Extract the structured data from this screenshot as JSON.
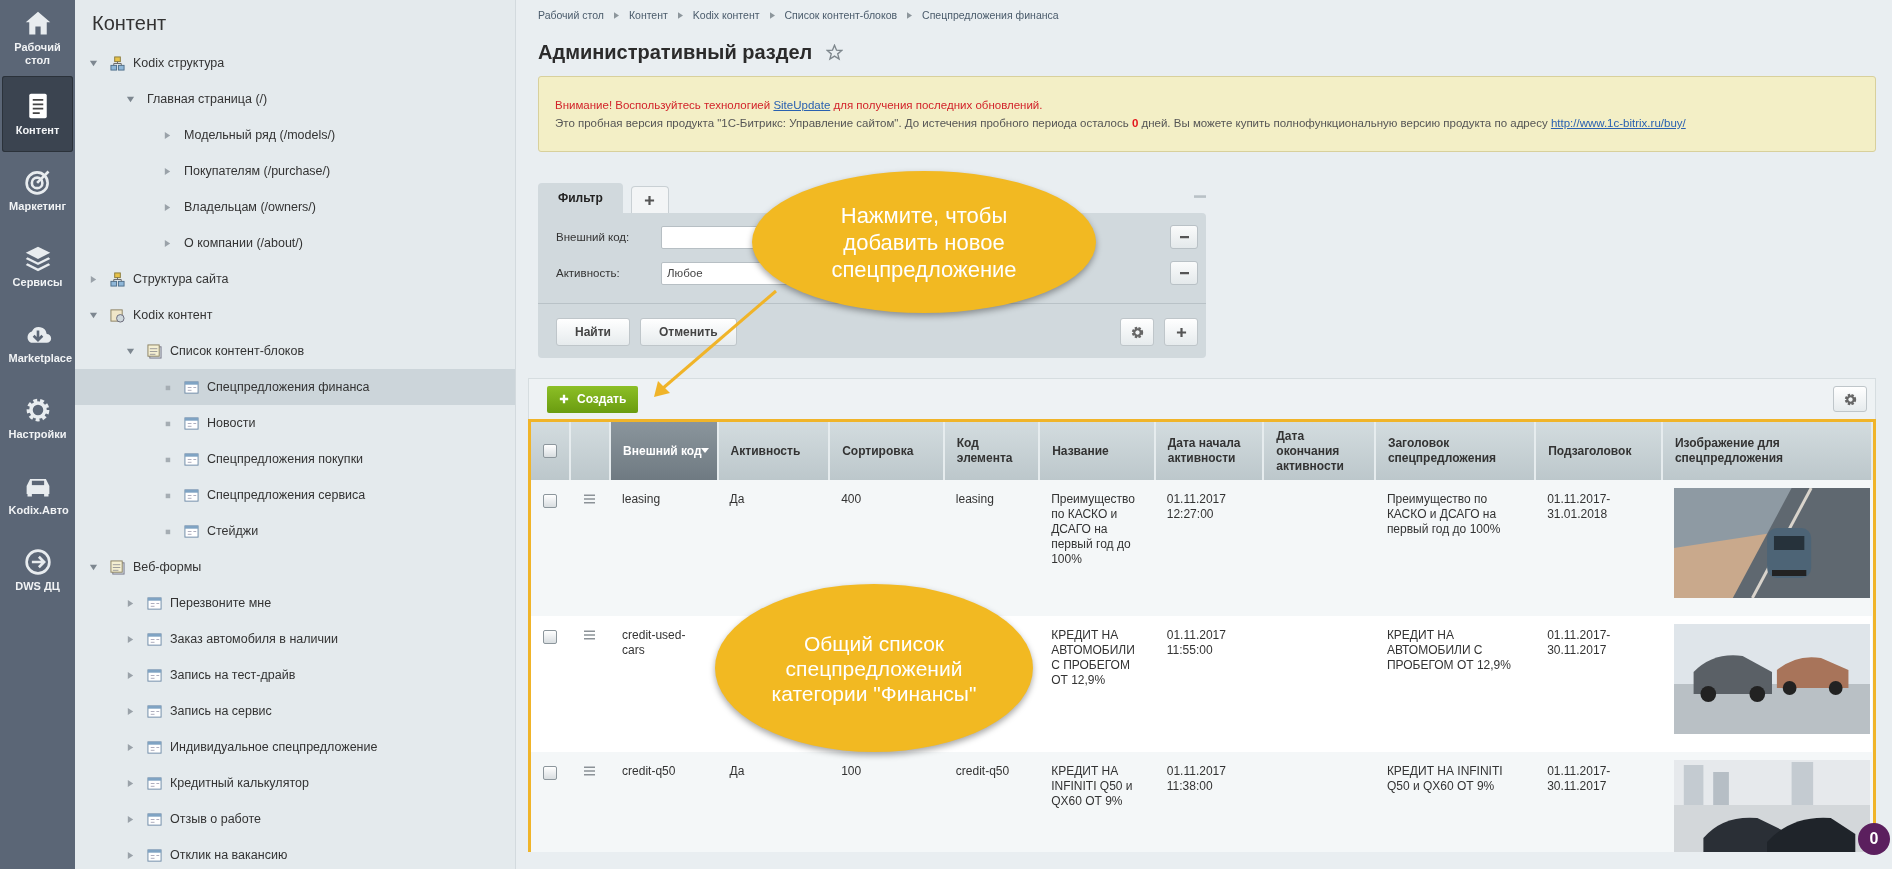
{
  "nav": [
    {
      "label": "Рабочий стол",
      "kind": "home",
      "selected": false
    },
    {
      "label": "Контент",
      "kind": "content",
      "selected": true
    },
    {
      "label": "Маркетинг",
      "kind": "target",
      "selected": false
    },
    {
      "label": "Сервисы",
      "kind": "layers",
      "selected": false
    },
    {
      "label": "Marketplace",
      "kind": "cloud",
      "selected": false
    },
    {
      "label": "Настройки",
      "kind": "gear",
      "selected": false
    },
    {
      "label": "Kodix.Авто",
      "kind": "car",
      "selected": false
    },
    {
      "label": "DWS ДЦ",
      "kind": "arrow",
      "selected": false
    }
  ],
  "tree": {
    "title": "Контент",
    "items": [
      {
        "label": "Kodix структура",
        "kind": "structure",
        "expanded": true,
        "selected": false,
        "children": [
          {
            "label": "Главная страница (/)",
            "kind": "none",
            "expanded": true,
            "selected": false,
            "children": [
              {
                "label": "Модельный ряд (/models/)",
                "kind": "none",
                "expanded": false,
                "selected": false
              },
              {
                "label": "Покупателям (/purchase/)",
                "kind": "none",
                "expanded": false,
                "selected": false
              },
              {
                "label": "Владельцам (/owners/)",
                "kind": "none",
                "expanded": false,
                "selected": false
              },
              {
                "label": "О компании (/about/)",
                "kind": "none",
                "expanded": false,
                "selected": false
              }
            ]
          }
        ]
      },
      {
        "label": "Структура сайта",
        "kind": "structure",
        "expanded": false,
        "selected": false
      },
      {
        "label": "Kodix контент",
        "kind": "content",
        "expanded": true,
        "selected": false,
        "children": [
          {
            "label": "Список контент-блоков",
            "kind": "list",
            "expanded": true,
            "selected": false,
            "children": [
              {
                "label": "Спецпредложения финанса",
                "kind": "block",
                "selected": true
              },
              {
                "label": "Новости",
                "kind": "block",
                "selected": false
              },
              {
                "label": "Спецпредложения покупки",
                "kind": "block",
                "selected": false
              },
              {
                "label": "Спецпредложения сервиса",
                "kind": "block",
                "selected": false
              },
              {
                "label": "Стейджи",
                "kind": "block",
                "selected": false
              }
            ]
          }
        ]
      },
      {
        "label": "Веб-формы",
        "kind": "list",
        "expanded": true,
        "selected": false,
        "children": [
          {
            "label": "Перезвоните мне",
            "kind": "block",
            "expanded": false,
            "selected": false
          },
          {
            "label": "Заказ автомобиля в наличии",
            "kind": "block",
            "expanded": false,
            "selected": false
          },
          {
            "label": "Запись на тест-драйв",
            "kind": "block",
            "expanded": false,
            "selected": false
          },
          {
            "label": "Запись на сервис",
            "kind": "block",
            "expanded": false,
            "selected": false
          },
          {
            "label": "Индивидуальное спецпредложение",
            "kind": "block",
            "expanded": false,
            "selected": false
          },
          {
            "label": "Кредитный калькулятор",
            "kind": "block",
            "expanded": false,
            "selected": false
          },
          {
            "label": "Отзыв о работе",
            "kind": "block",
            "expanded": false,
            "selected": false
          },
          {
            "label": "Отклик на вакансию",
            "kind": "block",
            "expanded": false,
            "selected": false
          }
        ]
      }
    ]
  },
  "breadcrumbs": [
    "Рабочий стол",
    "Контент",
    "Kodix контент",
    "Список контент-блоков",
    "Спецпредложения финанса"
  ],
  "title": "Административный раздел",
  "notice": [
    {
      "kind": "warning",
      "parts": [
        {
          "text": "Внимание! Воспользуйтесь технологией "
        },
        {
          "text": "SiteUpdate",
          "link": true
        },
        {
          "text": " для получения последних обновлений."
        }
      ]
    },
    {
      "kind": "info",
      "parts": [
        {
          "text": "Это пробная версия продукта \"1С-Битрикс: Управление сайтом\". До истечения пробного периода осталось **0** дней. Вы можете купить полнофункциональную версию продукта по адресу "
        },
        {
          "text": "http://www.1c-bitrix.ru/buy/",
          "link": true
        }
      ]
    }
  ],
  "filter": {
    "tabs": [
      {
        "label": "Фильтр",
        "selected": true
      }
    ],
    "fields": [
      {
        "label": "Внешний код:",
        "kind": "text"
      },
      {
        "label": "Активность:",
        "kind": "select",
        "value": "Любое"
      }
    ],
    "buttons": [
      "Найти",
      "Отменить"
    ]
  },
  "create_button": "Создать",
  "table": {
    "select_all": {
      "checked": false
    },
    "columns": [
      {
        "label": "Внешний код",
        "sorted": true
      },
      {
        "label": "Активность",
        "sorted": false
      },
      {
        "label": "Сортировка",
        "sorted": false
      },
      {
        "label": "Код элемента",
        "sorted": false
      },
      {
        "label": "Название",
        "sorted": false
      },
      {
        "label": "Дата начала активности",
        "sorted": false
      },
      {
        "label": "Дата окончания активности",
        "sorted": false
      },
      {
        "label": "Заголовок спецпредложения",
        "sorted": false
      },
      {
        "label": "Подзаголовок",
        "sorted": false
      },
      {
        "label": "Изображение для спецпредложения",
        "sorted": false
      }
    ],
    "rows": [
      {
        "checked": false,
        "cells": [
          "leasing",
          "Да",
          "400",
          "leasing",
          "Преимущество по КАСКО и ДСАГО на первый год до 100%",
          "01.11.2017 12:27:00",
          null,
          "Преимущество по КАСКО и ДСАГО на первый год до 100%",
          "01.11.2017-31.01.2018"
        ],
        "image": {
          "kind": "picture"
        }
      },
      {
        "checked": false,
        "cells": [
          "credit-used-cars",
          null,
          null,
          null,
          "КРЕДИТ НА АВТОМОБИЛИ С ПРОБЕГОМ ОТ 12,9%",
          "01.11.2017 11:55:00",
          null,
          "КРЕДИТ НА АВТОМОБИЛИ С ПРОБЕГОМ ОТ 12,9%",
          "01.11.2017-30.11.2017"
        ],
        "image": {
          "kind": "picture"
        }
      },
      {
        "checked": false,
        "cells": [
          "credit-q50",
          "Да",
          "100",
          "credit-q50",
          "КРЕДИТ НА INFINITI Q50 и QX60 ОТ 9%",
          "01.11.2017 11:38:00",
          null,
          "КРЕДИТ НА INFINITI Q50 и QX60 ОТ 9%",
          "01.11.2017-30.11.2017"
        ],
        "image": {
          "kind": "picture"
        }
      }
    ]
  },
  "callouts": [
    {
      "text": "Нажмите, чтобы добавить новое спецпредложение"
    },
    {
      "text": "Общий список спецпредложений категории \"Финансы\""
    }
  ],
  "badge": "0"
}
